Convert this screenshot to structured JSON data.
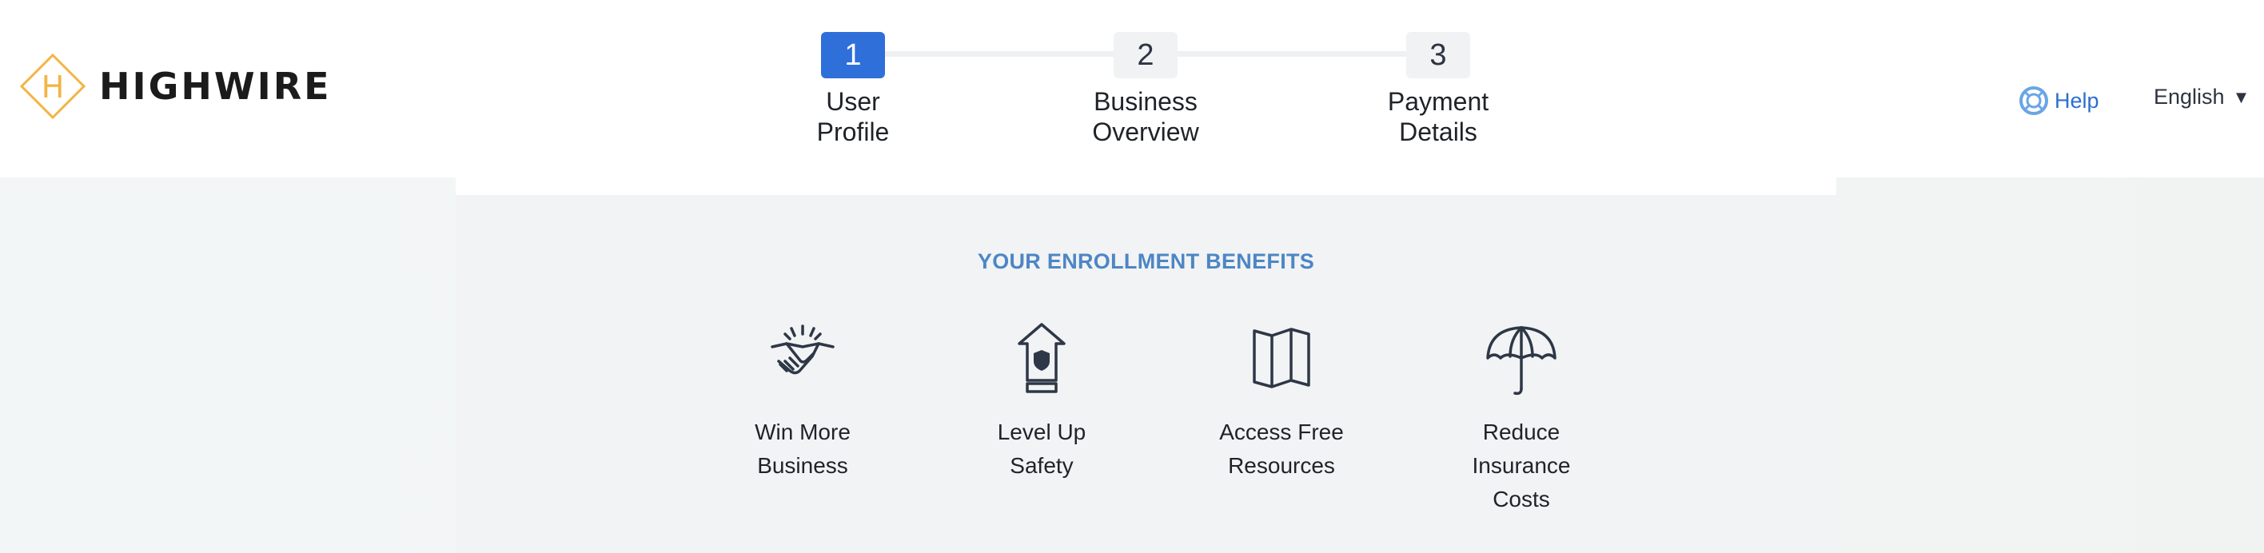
{
  "brand": {
    "name": "HIGHWIRE",
    "mark_letter": "H",
    "accent": "#f2b544"
  },
  "stepper": {
    "steps": [
      {
        "number": "1",
        "label": "User\nProfile",
        "active": true
      },
      {
        "number": "2",
        "label": "Business\nOverview",
        "active": false
      },
      {
        "number": "3",
        "label": "Payment\nDetails",
        "active": false
      }
    ],
    "active_color": "#2f6fd9"
  },
  "header": {
    "help_label": "Help",
    "help_icon": "lifebuoy-icon",
    "language": "English",
    "language_caret": "▼"
  },
  "benefits": {
    "title": "YOUR ENROLLMENT BENEFITS",
    "title_color": "#4d86c4",
    "items": [
      {
        "label": "Win More\nBusiness",
        "icon": "handshake-icon"
      },
      {
        "label": "Level Up\nSafety",
        "icon": "shield-arrow-icon"
      },
      {
        "label": "Access Free\nResources",
        "icon": "map-icon"
      },
      {
        "label": "Reduce\nInsurance\nCosts",
        "icon": "umbrella-icon"
      }
    ]
  }
}
